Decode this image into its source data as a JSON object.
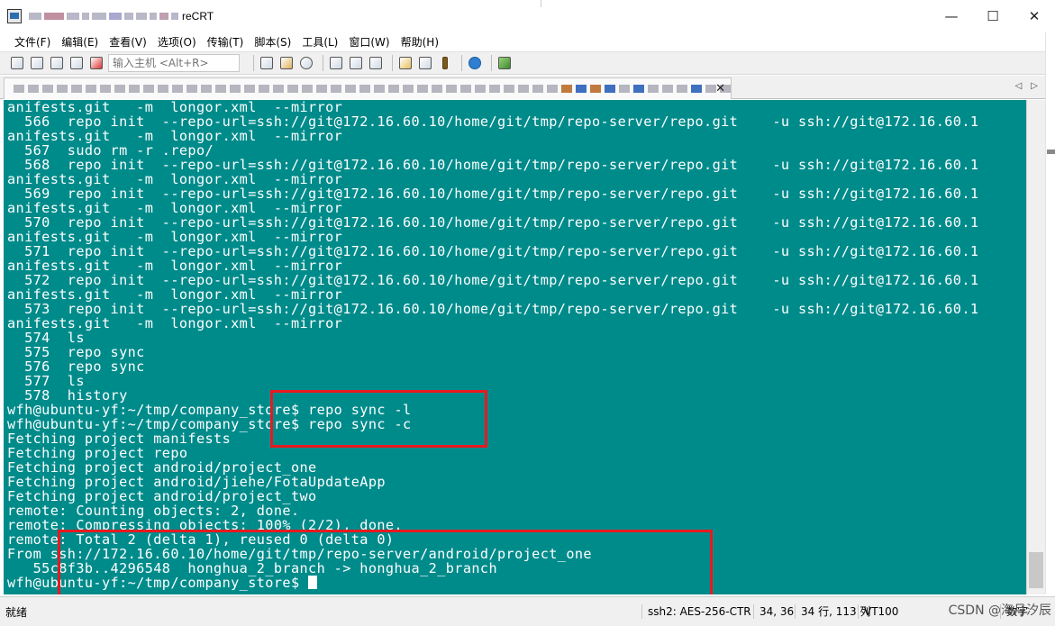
{
  "window": {
    "title": "reCRT",
    "controls": {
      "minimize": "—",
      "maximize": "☐",
      "close": "✕"
    }
  },
  "menu": [
    "文件(F)",
    "编辑(E)",
    "查看(V)",
    "选项(O)",
    "传输(T)",
    "脚本(S)",
    "工具(L)",
    "窗口(W)",
    "帮助(H)"
  ],
  "toolbar": {
    "host_placeholder": "输入主机 <Alt+R>",
    "icons": [
      "connect-icon",
      "quick-connect-icon",
      "reconnect-icon",
      "disconnect-icon",
      "disconnect-all-icon",
      "copy-icon",
      "paste-icon",
      "find-icon",
      "print-icon",
      "print-setup-icon",
      "print-screen-icon",
      "session-options-icon",
      "global-options-icon",
      "keymap-icon",
      "help-icon",
      "sftp-icon"
    ]
  },
  "tab": {
    "close": "✕",
    "arrow_left": "◁",
    "arrow_right": "▷"
  },
  "terminal": {
    "lines": [
      "anifests.git   -m  longor.xml  --mirror",
      "  566  repo init  --repo-url=ssh://git@172.16.60.10/home/git/tmp/repo-server/repo.git    -u ssh://git@172.16.60.1",
      "anifests.git   -m  longor.xml  --mirror",
      "  567  sudo rm -r .repo/",
      "  568  repo init  --repo-url=ssh://git@172.16.60.10/home/git/tmp/repo-server/repo.git    -u ssh://git@172.16.60.1",
      "anifests.git   -m  longor.xml  --mirror",
      "  569  repo init  --repo-url=ssh://git@172.16.60.10/home/git/tmp/repo-server/repo.git    -u ssh://git@172.16.60.1",
      "anifests.git   -m  longor.xml  --mirror",
      "  570  repo init  --repo-url=ssh://git@172.16.60.10/home/git/tmp/repo-server/repo.git    -u ssh://git@172.16.60.1",
      "anifests.git   -m  longor.xml  --mirror",
      "  571  repo init  --repo-url=ssh://git@172.16.60.10/home/git/tmp/repo-server/repo.git    -u ssh://git@172.16.60.1",
      "anifests.git   -m  longor.xml  --mirror",
      "  572  repo init  --repo-url=ssh://git@172.16.60.10/home/git/tmp/repo-server/repo.git    -u ssh://git@172.16.60.1",
      "anifests.git   -m  longor.xml  --mirror",
      "  573  repo init  --repo-url=ssh://git@172.16.60.10/home/git/tmp/repo-server/repo.git    -u ssh://git@172.16.60.1",
      "anifests.git   -m  longor.xml  --mirror",
      "  574  ls",
      "  575  repo sync",
      "  576  repo sync",
      "  577  ls",
      "  578  history",
      "wfh@ubuntu-yf:~/tmp/company_store$ repo sync -l",
      "wfh@ubuntu-yf:~/tmp/company_store$ repo sync -c",
      "Fetching project manifests",
      "Fetching project repo",
      "Fetching project android/project_one",
      "Fetching project android/jiehe/FotaUpdateApp",
      "Fetching project android/project_two",
      "remote: Counting objects: 2, done.",
      "remote: Compressing objects: 100% (2/2), done.",
      "remote: Total 2 (delta 1), reused 0 (delta 0)",
      "From ssh://172.16.60.10/home/git/tmp/repo-server/android/project_one",
      "   55c8f3b..4296548  honghua_2_branch -> honghua_2_branch",
      "wfh@ubuntu-yf:~/tmp/company_store$ "
    ],
    "background_color": "#008b8b",
    "highlight_color": "#e8191f"
  },
  "status": {
    "ready": "就绪",
    "encryption": "ssh2: AES-256-CTR",
    "cursor_pos": "34,  36",
    "rows_cols": "34 行, 113 列",
    "terminal_type": "VT100",
    "caps": "数字",
    "source_badge": "CSDN @海月汐辰"
  }
}
